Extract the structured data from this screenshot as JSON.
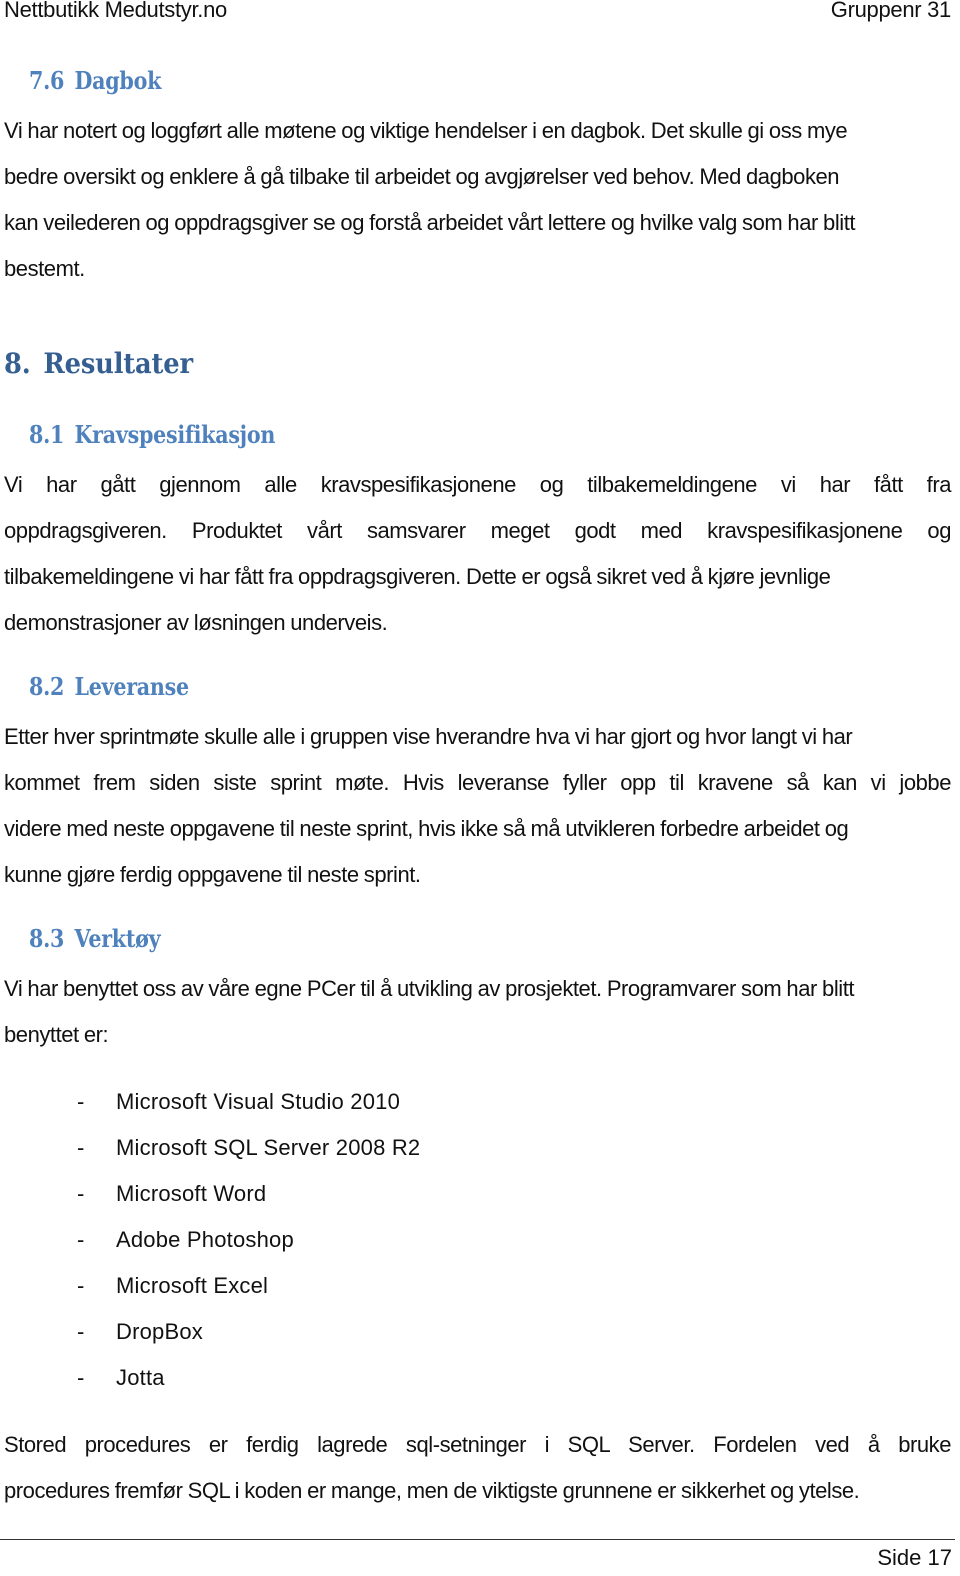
{
  "header": {
    "left": "Nettbutikk Medutstyr.no",
    "right": "Gruppenr 31"
  },
  "sections": {
    "dagbok": {
      "number": "7.6",
      "title": "Dagbok",
      "lines": [
        "Vi har notert og loggført alle møtene og viktige hendelser i en dagbok. Det skulle gi oss mye",
        "bedre oversikt og enklere å gå tilbake til arbeidet og avgjørelser ved behov. Med dagboken",
        "kan veilederen og oppdragsgiver se og forstå arbeidet vårt lettere og hvilke valg som har blitt",
        "bestemt."
      ]
    },
    "resultater": {
      "number": "8.",
      "title": "Resultater"
    },
    "kravspesifikasjon": {
      "number": "8.1",
      "title": "Kravspesifikasjon",
      "lines": [
        "Vi har gått gjennom alle kravspesifikasjonene og tilbakemeldingene vi har fått fra",
        "oppdragsgiveren. Produktet vårt samsvarer meget godt med kravspesifikasjonene og",
        "tilbakemeldingene vi har fått fra oppdragsgiveren. Dette er også sikret ved å kjøre jevnlige",
        "demonstrasjoner av løsningen underveis."
      ]
    },
    "leveranse": {
      "number": "8.2",
      "title": "Leveranse",
      "lines": [
        "Etter hver sprintmøte skulle alle i gruppen vise hverandre hva vi har gjort og hvor langt vi har",
        "kommet frem siden siste sprint møte. Hvis leveranse fyller opp til kravene så kan vi jobbe",
        "videre med neste oppgavene til neste sprint, hvis ikke så må utvikleren forbedre arbeidet og",
        "kunne gjøre ferdig oppgavene til neste sprint."
      ]
    },
    "verktoy": {
      "number": "8.3",
      "title": "Verktøy",
      "lines": [
        "Vi har benyttet oss av våre egne PCer til å utvikling av prosjektet. Programvarer som har blitt",
        "benyttet er:"
      ],
      "list_marker": "-",
      "list": [
        "Microsoft Visual Studio 2010",
        "Microsoft SQL Server 2008 R2",
        "Microsoft Word",
        "Adobe Photoshop",
        "Microsoft Excel",
        "DropBox",
        "Jotta"
      ],
      "closing_lines": [
        "Stored procedures er ferdig lagrede sql-setninger i SQL Server. Fordelen ved å bruke",
        "procedures fremfør SQL i koden er mange, men de viktigste grunnene er sikkerhet og ytelse."
      ]
    }
  },
  "footer": {
    "page_label": "Side 17"
  },
  "colors": {
    "heading1": "#365f91",
    "heading2": "#4f81bd",
    "body_text": "#111111"
  }
}
